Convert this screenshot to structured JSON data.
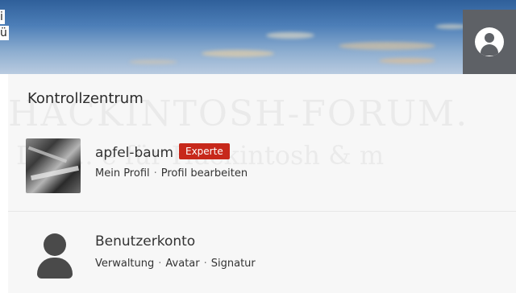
{
  "header": {
    "clipped_texts": [
      "i",
      "ü"
    ],
    "user_icon": "user-circle-icon"
  },
  "panel": {
    "title": "Kontrollzentrum",
    "watermark_line1": "HACKINTOSH-FORUM.",
    "watermark_line2": "Die ... e für Hackintosh & m"
  },
  "profile": {
    "username": "apfel-baum",
    "badge": "Experte",
    "badge_color": "#c7281b",
    "links": [
      "Mein Profil",
      "Profil bearbeiten"
    ],
    "separator": "·"
  },
  "account": {
    "title": "Benutzerkonto",
    "icon": "person-icon",
    "links": [
      "Verwaltung",
      "Avatar",
      "Signatur"
    ],
    "separator": "·"
  }
}
